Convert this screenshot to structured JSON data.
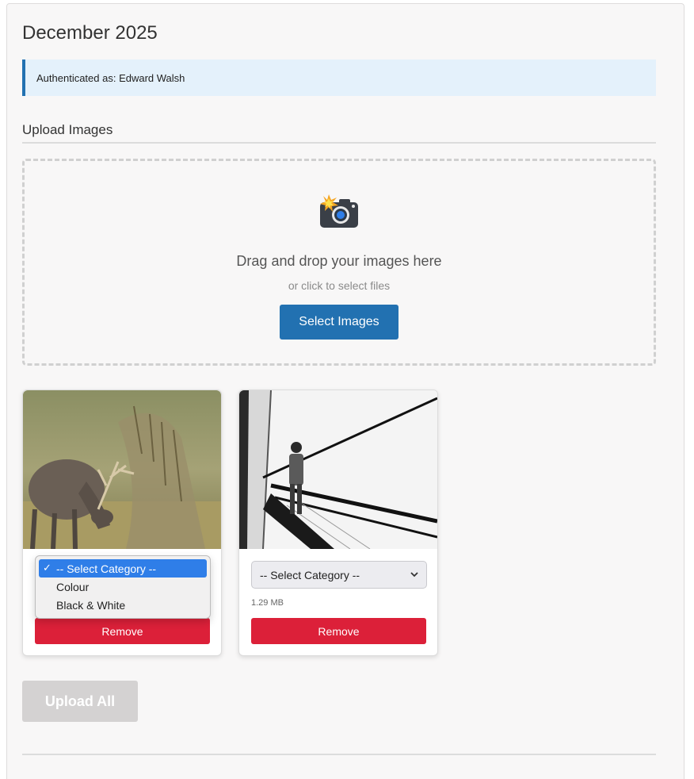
{
  "page": {
    "title": "December 2025"
  },
  "auth": {
    "text": "Authenticated as: Edward Walsh"
  },
  "upload": {
    "heading": "Upload Images",
    "drop_text": "Drag and drop your images here",
    "drop_subtext": "or click to select files",
    "select_button": "Select Images",
    "icon": "camera-flash-icon"
  },
  "cards": [
    {
      "image": "deer-stag-photo",
      "category_placeholder": "-- Select Category --",
      "dropdown_open": true,
      "options": [
        "-- Select Category --",
        "Colour",
        "Black & White"
      ],
      "remove_label": "Remove"
    },
    {
      "image": "escalator-bw-photo",
      "category_placeholder": "-- Select Category --",
      "dropdown_open": false,
      "file_size": "1.29 MB",
      "remove_label": "Remove"
    }
  ],
  "actions": {
    "upload_all": "Upload All"
  },
  "colors": {
    "primary": "#2271b1",
    "danger": "#dc2039",
    "disabled": "#d4d2d2",
    "info_bg": "#e4f1fb"
  }
}
